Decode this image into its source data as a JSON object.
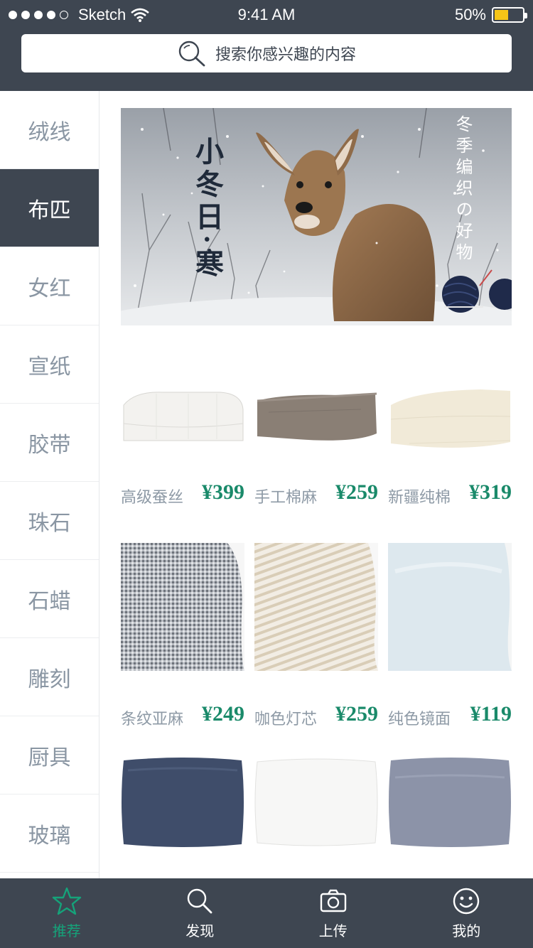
{
  "status": {
    "carrier": "Sketch",
    "time": "9:41 AM",
    "battery": "50%",
    "battery_level": 0.5
  },
  "search": {
    "placeholder": "搜索你感兴趣的内容",
    "icon": "search-icon"
  },
  "sidebar": {
    "items": [
      {
        "label": "绒线",
        "active": false
      },
      {
        "label": "布匹",
        "active": true
      },
      {
        "label": "女红",
        "active": false
      },
      {
        "label": "宣纸",
        "active": false
      },
      {
        "label": "胶带",
        "active": false
      },
      {
        "label": "珠石",
        "active": false
      },
      {
        "label": "石蜡",
        "active": false
      },
      {
        "label": "雕刻",
        "active": false
      },
      {
        "label": "厨具",
        "active": false
      },
      {
        "label": "玻璃",
        "active": false
      }
    ]
  },
  "banner": {
    "title_left": "小冬日·寒",
    "title_right": "冬季编织の好物"
  },
  "products": [
    {
      "name": "高级蚕丝",
      "price": "¥399",
      "kind": "duvet-white"
    },
    {
      "name": "手工棉麻",
      "price": "¥259",
      "kind": "blanket-brown"
    },
    {
      "name": "新疆纯棉",
      "price": "¥319",
      "kind": "blanket-cream"
    },
    {
      "name": "条纹亚麻",
      "price": "¥249",
      "kind": "pillow-gingham"
    },
    {
      "name": "咖色灯芯",
      "price": "¥259",
      "kind": "pillow-stripe"
    },
    {
      "name": "纯色镜面",
      "price": "¥119",
      "kind": "pillow-lightblue"
    },
    {
      "name": "",
      "price": "",
      "kind": "pillow-navy"
    },
    {
      "name": "",
      "price": "",
      "kind": "pillow-white"
    },
    {
      "name": "",
      "price": "",
      "kind": "pillow-grey"
    }
  ],
  "tabbar": {
    "tabs": [
      {
        "label": "推荐",
        "icon": "star-icon",
        "active": true
      },
      {
        "label": "发现",
        "icon": "search-icon",
        "active": false
      },
      {
        "label": "上传",
        "icon": "camera-icon",
        "active": false
      },
      {
        "label": "我的",
        "icon": "smiley-icon",
        "active": false
      }
    ]
  },
  "colors": {
    "header": "#3e4651",
    "accent": "#15a37a",
    "price": "#1a8a6a",
    "muted_text": "#8a96a3"
  }
}
